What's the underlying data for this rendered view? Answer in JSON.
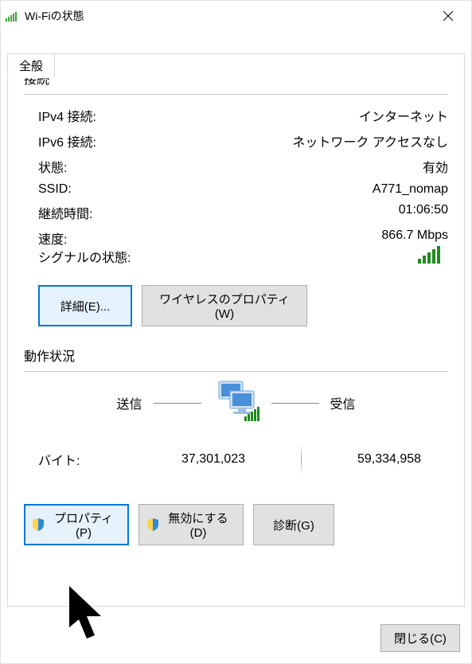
{
  "window": {
    "title": "Wi-Fiの状態"
  },
  "tab": {
    "general": "全般"
  },
  "connection": {
    "section_label": "接続",
    "ipv4_label": "IPv4 接続:",
    "ipv4_value": "インターネット",
    "ipv6_label": "IPv6 接続:",
    "ipv6_value": "ネットワーク アクセスなし",
    "state_label": "状態:",
    "state_value": "有効",
    "ssid_label": "SSID:",
    "ssid_value": "A771_nomap",
    "duration_label": "継続時間:",
    "duration_value": "01:06:50",
    "speed_label": "速度:",
    "speed_value": "866.7 Mbps",
    "signal_label": "シグナルの状態:"
  },
  "buttons": {
    "details": "詳細(E)...",
    "wireless_properties": "ワイヤレスのプロパティ(W)",
    "properties": "プロパティ(P)",
    "disable": "無効にする(D)",
    "diagnose": "診断(G)",
    "close": "閉じる(C)"
  },
  "activity": {
    "section_label": "動作状況",
    "sent_label": "送信",
    "received_label": "受信",
    "bytes_label": "バイト:",
    "sent_bytes": "37,301,023",
    "received_bytes": "59,334,958"
  }
}
